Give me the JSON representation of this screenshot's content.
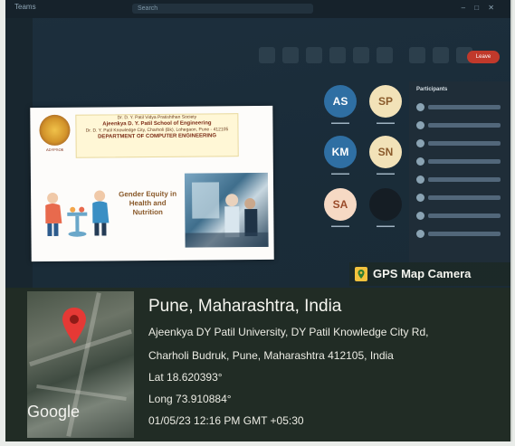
{
  "app": {
    "title": "Teams",
    "search_placeholder": "Search"
  },
  "meeting": {
    "leave_label": "Leave",
    "participants_title": "Participants"
  },
  "slide": {
    "logo_caption": "ADYPSOE",
    "header_lines": [
      "Dr. D. Y. Patil Vidya Pratishthan Society",
      "Ajeenkya D. Y. Patil School of Engineering",
      "Dr. D. Y. Patil Knowledge City, Charholi (Bk), Lohegaon, Pune - 412105",
      "DEPARTMENT OF COMPUTER ENGINEERING"
    ],
    "title": "Gender Equity in Health and Nutrition"
  },
  "participants": [
    {
      "initials": "AS",
      "color": "#2f6fa3",
      "text_color": "#ffffff"
    },
    {
      "initials": "SP",
      "color": "#f2e2b8",
      "text_color": "#8a5a2b"
    },
    {
      "initials": "KM",
      "color": "#2f6fa3",
      "text_color": "#ffffff"
    },
    {
      "initials": "SN",
      "color": "#f2e2b8",
      "text_color": "#8a5a2b"
    },
    {
      "initials": "SA",
      "color": "#f6d9c4",
      "text_color": "#9a4b2a"
    },
    {
      "initials": "",
      "color": "#151d24",
      "text_color": "#ffffff"
    }
  ],
  "gps": {
    "badge_label": "GPS Map Camera",
    "city": "Pune, Maharashtra, India",
    "address_line1": "Ajeenkya DY Patil University, DY Patil Knowledge City Rd,",
    "address_line2": "Charholi Budruk, Pune, Maharashtra 412105, India",
    "lat": "Lat 18.620393°",
    "long": "Long 73.910884°",
    "datetime": "01/05/23 12:16 PM GMT +05:30",
    "map_provider": "Google",
    "pin_color": "#e53935"
  }
}
